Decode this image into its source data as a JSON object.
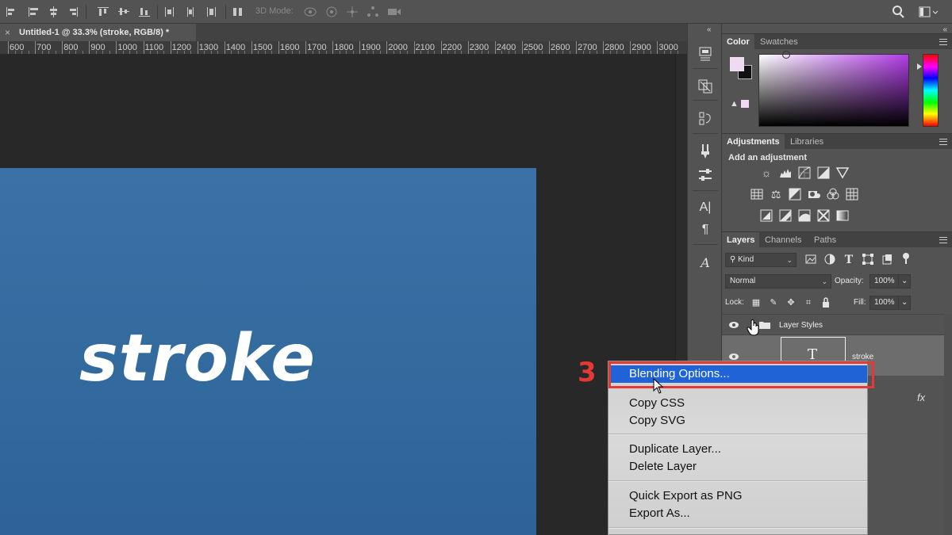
{
  "options_bar": {
    "mode_3d_label": "3D Mode:"
  },
  "document_tab": {
    "close_glyph": "×",
    "title": "Untitled-1 @ 33.3% (stroke, RGB/8) *"
  },
  "ruler": {
    "ticks": [
      "600",
      "700",
      "800",
      "900",
      "1000",
      "1100",
      "1200",
      "1300",
      "1400",
      "1500",
      "1600",
      "1700",
      "1800",
      "1900",
      "2000",
      "2100",
      "2200",
      "2300",
      "2400",
      "2500",
      "2600",
      "2700",
      "2800",
      "2900",
      "3000"
    ]
  },
  "canvas": {
    "text": "stroke",
    "background_color": "#336b9f"
  },
  "color_panel": {
    "tabs": [
      "Color",
      "Swatches"
    ],
    "foreground_color": "#f1d8f3",
    "background_color": "#111111"
  },
  "adjustments_panel": {
    "tabs": [
      "Adjustments",
      "Libraries"
    ],
    "title": "Add an adjustment",
    "row1": [
      "brightness-contrast-icon",
      "levels-icon",
      "curves-icon",
      "exposure-icon",
      "vibrance-icon"
    ],
    "row2": [
      "hue-saturation-icon",
      "color-balance-icon",
      "black-white-icon",
      "photo-filter-icon",
      "channel-mixer-icon",
      "color-lookup-icon"
    ],
    "row3": [
      "invert-icon",
      "posterize-icon",
      "threshold-icon",
      "selective-color-icon",
      "gradient-map-icon"
    ]
  },
  "layers_panel": {
    "tabs": [
      "Layers",
      "Channels",
      "Paths"
    ],
    "filter_kind": "Kind",
    "blend_mode": "Normal",
    "opacity_label": "Opacity:",
    "opacity_value": "100%",
    "lock_label": "Lock:",
    "fill_label": "Fill:",
    "fill_value": "100%",
    "layers": [
      {
        "name": "Layer Styles",
        "type": "group"
      },
      {
        "name": "stroke",
        "type": "text",
        "thumb_glyph": "T"
      }
    ],
    "fx_label": "fx"
  },
  "context_menu": {
    "items": [
      {
        "label": "Blending Options...",
        "highlighted": true
      },
      {
        "label": "Copy CSS"
      },
      {
        "label": "Copy SVG"
      },
      {
        "label": "Duplicate Layer..."
      },
      {
        "label": "Delete Layer"
      },
      {
        "label": "Quick Export as PNG"
      },
      {
        "label": "Export As..."
      }
    ]
  },
  "annotation": {
    "step": "3",
    "color": "#e53935"
  }
}
